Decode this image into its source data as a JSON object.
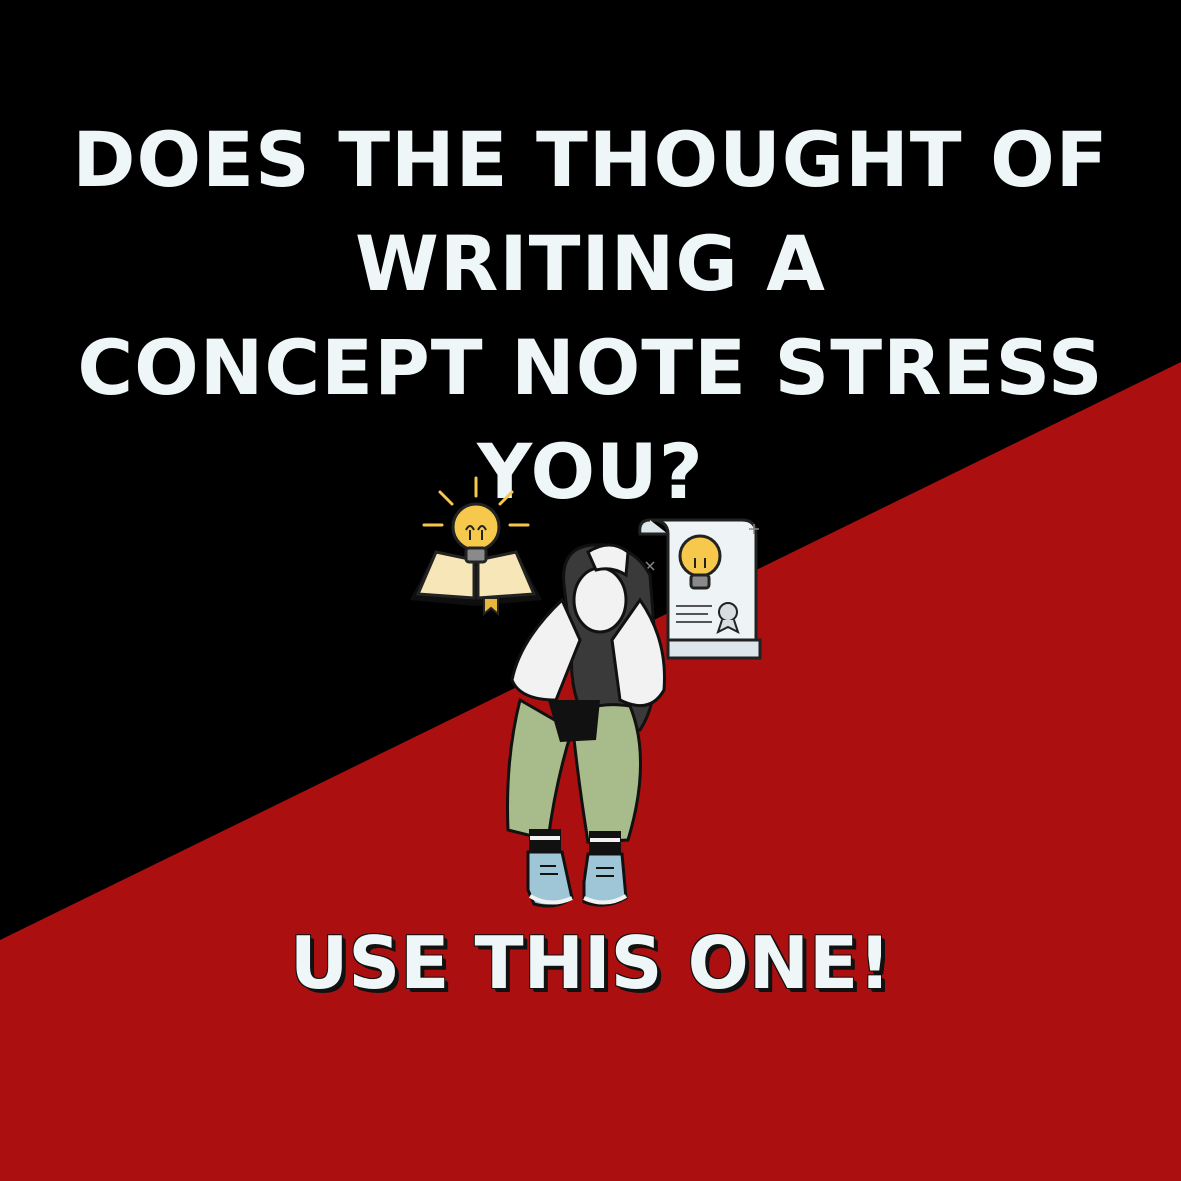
{
  "headline": {
    "lines": [
      "DOES THE THOUGHT OF",
      "WRITING A",
      "CONCEPT NOTE STRESS",
      "YOU?"
    ]
  },
  "cta": "USE THIS ONE!",
  "colors": {
    "dark_background": "#000000",
    "red_background": "#ab0f0f",
    "text": "#eef6f7",
    "bulb_yellow": "#f6c94c",
    "pants_green": "#a8bb8a"
  },
  "icons": [
    "idea-book-icon",
    "idea-certificate-icon",
    "stressed-person-illustration"
  ]
}
